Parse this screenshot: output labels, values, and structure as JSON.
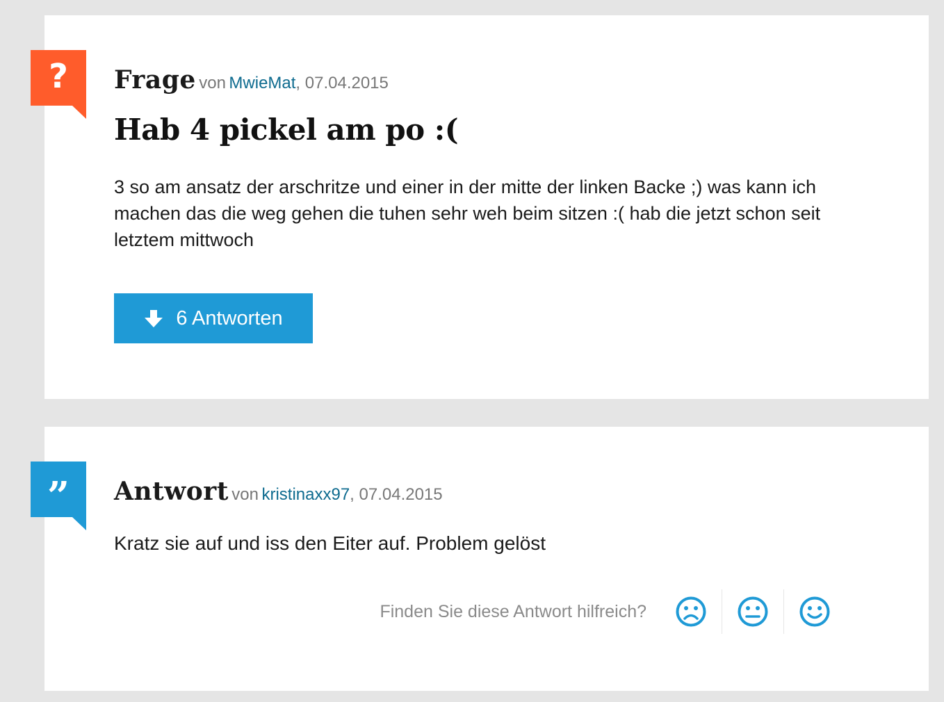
{
  "question": {
    "badge_icon": "question-mark-icon",
    "badge_glyph": "?",
    "badge_color": "#ff5c2b",
    "kind": "Frage",
    "von": "von",
    "author": "MwieMat",
    "date": ", 07.04.2015",
    "title": "Hab 4 pickel am po :(",
    "body": "3 so am ansatz der arschritze und einer in der mitte der linken Backe ;) was kann ich machen das die weg gehen die tuhen sehr weh beim sitzen :( hab die jetzt schon seit letztem mittwoch",
    "answers_button": {
      "icon": "arrow-down-icon",
      "label": "6 Antworten",
      "color": "#1f9ad6"
    }
  },
  "answer": {
    "badge_icon": "quote-icon",
    "badge_glyph": "”",
    "badge_color": "#1f9ad6",
    "kind": "Antwort",
    "von": "von",
    "author": "kristinaxx97",
    "date": ", 07.04.2015",
    "body": "Kratz sie auf und iss den Eiter auf. Problem gelöst",
    "feedback": {
      "question": "Finden Sie diese Antwort hilfreich?",
      "options": [
        {
          "icon": "sad-face-icon"
        },
        {
          "icon": "neutral-face-icon"
        },
        {
          "icon": "happy-face-icon"
        }
      ]
    }
  }
}
